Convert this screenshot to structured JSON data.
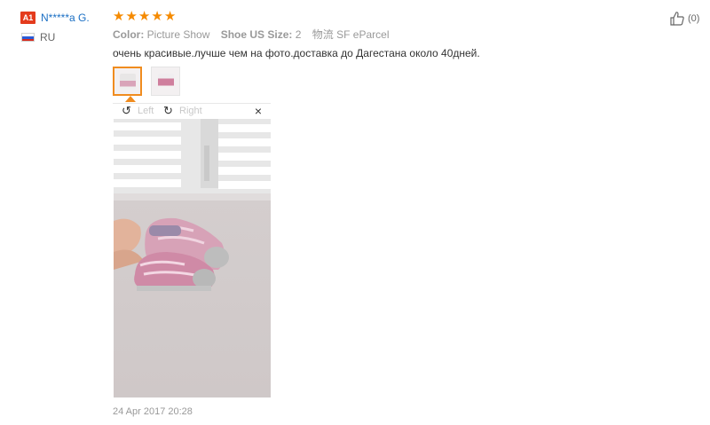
{
  "user": {
    "level": "A1",
    "name": "N*****a G.",
    "country": "RU"
  },
  "review": {
    "stars": [
      "★",
      "★",
      "★",
      "★",
      "★"
    ],
    "attributes": [
      {
        "label": "Color:",
        "value": "Picture Show"
      },
      {
        "label": "Shoe US Size:",
        "value": "2"
      },
      {
        "label": "物流",
        "value": "SF eParcel"
      }
    ],
    "text": "очень красивые.лучше чем на фото.доставка до Дагестана около 40дней.",
    "date": "24 Apr 2017 20:28"
  },
  "preview": {
    "rotate_left": "Left",
    "rotate_right": "Right",
    "close": "×"
  },
  "helpful": {
    "count": "(0)"
  },
  "colors": {
    "star": "#f58a00",
    "accent": "#f08c1f",
    "link": "#1a6fc4",
    "badge": "#e43b1d"
  }
}
